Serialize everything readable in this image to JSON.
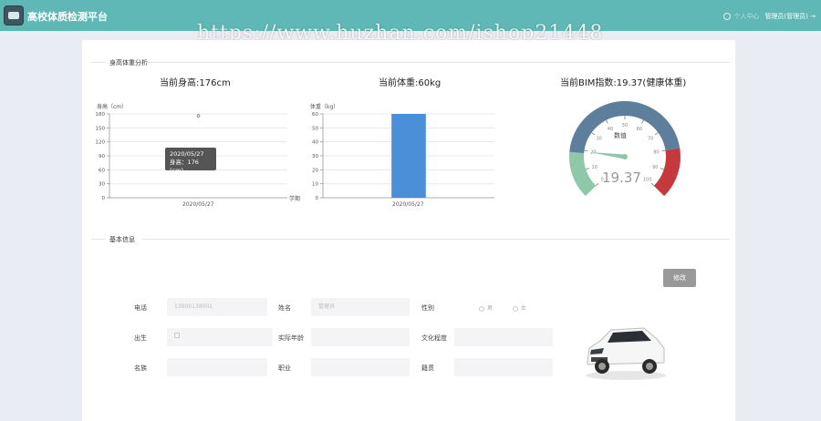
{
  "app": {
    "title": "高校体质检测平台"
  },
  "watermark": "https://www.huzhan.com/ishop21448",
  "header": {
    "faded_link": "个人中心",
    "user": "管理员(管理员)"
  },
  "analysis": {
    "section_title": "身高体重分析",
    "height_title": "当前身高:176cm",
    "weight_title": "当前体重:60kg",
    "bmi_title": "当前BIM指数:19.37(健康体重)"
  },
  "chart_data": [
    {
      "type": "line",
      "ylabel": "身高（cm）",
      "xlabel": "学期",
      "categories": [
        "2020/05/27"
      ],
      "series": [
        {
          "values": [
            176
          ]
        }
      ],
      "ylim": [
        0,
        180
      ],
      "yticks": [
        "180",
        "150",
        "120",
        "90",
        "60",
        "30",
        "0"
      ],
      "tooltip": {
        "date": "2020/05/27",
        "text": "身高：176 (cm)"
      }
    },
    {
      "type": "bar",
      "ylabel": "体重（kg）",
      "categories": [
        "2020/05/27"
      ],
      "values": [
        60
      ],
      "ylim": [
        0,
        60
      ],
      "yticks": [
        "60",
        "50",
        "40",
        "30",
        "20",
        "10",
        "0"
      ],
      "bar_color": "#4a8fd8"
    },
    {
      "type": "gauge",
      "name": "数值",
      "value": 19.37,
      "value_label": "19.37",
      "range": [
        0,
        100
      ],
      "ticks": [
        "0",
        "10",
        "20",
        "30",
        "40",
        "50",
        "60",
        "70",
        "80",
        "90",
        "100"
      ],
      "bands": [
        {
          "to": 18.5,
          "color": "#8fc8a8"
        },
        {
          "to": 80,
          "color": "#5d7f9c"
        },
        {
          "to": 100,
          "color": "#c5383c"
        }
      ]
    }
  ],
  "basic": {
    "section_title": "基本信息",
    "edit_button": "修改",
    "fields": {
      "phone": {
        "label": "电话",
        "value": "13800138001"
      },
      "name": {
        "label": "姓名",
        "value": "管理员"
      },
      "gender": {
        "label": "性别",
        "options": [
          "男",
          "女"
        ]
      },
      "birth": {
        "label": "出生",
        "value": ""
      },
      "actual_age": {
        "label": "实际年龄",
        "value": ""
      },
      "education": {
        "label": "文化程度",
        "value": ""
      },
      "ethnicity": {
        "label": "名族",
        "value": ""
      },
      "occupation": {
        "label": "职业",
        "value": ""
      },
      "native_place": {
        "label": "籍贯",
        "value": ""
      }
    }
  }
}
